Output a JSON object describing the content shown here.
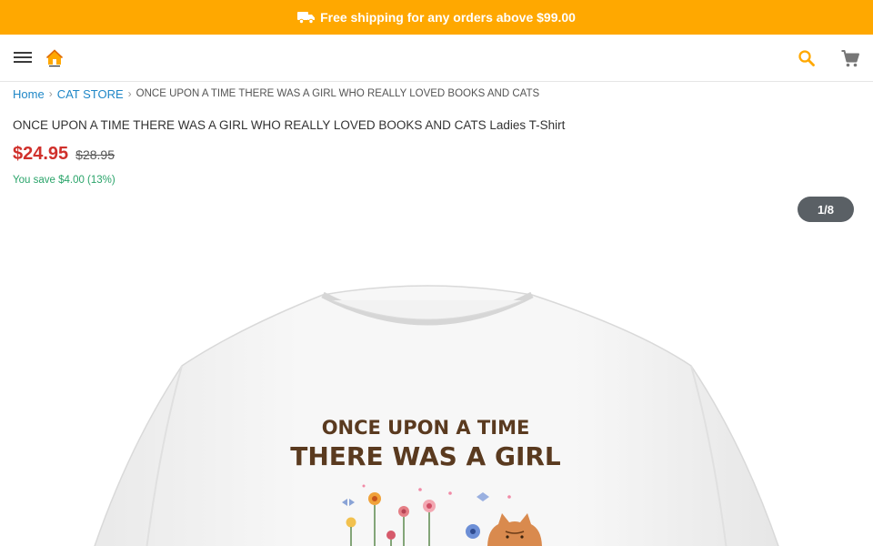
{
  "promo": {
    "text": "Free shipping for any orders above $99.00",
    "icon": "truck-icon",
    "background": "#ffa800"
  },
  "header": {
    "menu_icon": "hamburger-menu-icon",
    "logo_icon": "home-logo-icon",
    "search_icon": "search-icon",
    "cart_icon": "shopping-cart-icon",
    "accent": "#ffa800"
  },
  "breadcrumb": {
    "home": "Home",
    "category": "CAT STORE",
    "current": "ONCE UPON A TIME THERE WAS A GIRL WHO REALLY LOVED BOOKS AND CATS"
  },
  "product": {
    "title": "ONCE UPON A TIME THERE WAS A GIRL WHO REALLY LOVED BOOKS AND CATS Ladies T-Shirt",
    "price": "$24.95",
    "old_price": "$28.95",
    "savings": "You save $4.00 (13%)",
    "price_color": "#d0302b",
    "savings_color": "#2aa46a"
  },
  "gallery": {
    "counter": "1/8",
    "print_line1": "ONCE UPON A TIME",
    "print_line2": "THERE WAS A GIRL"
  }
}
